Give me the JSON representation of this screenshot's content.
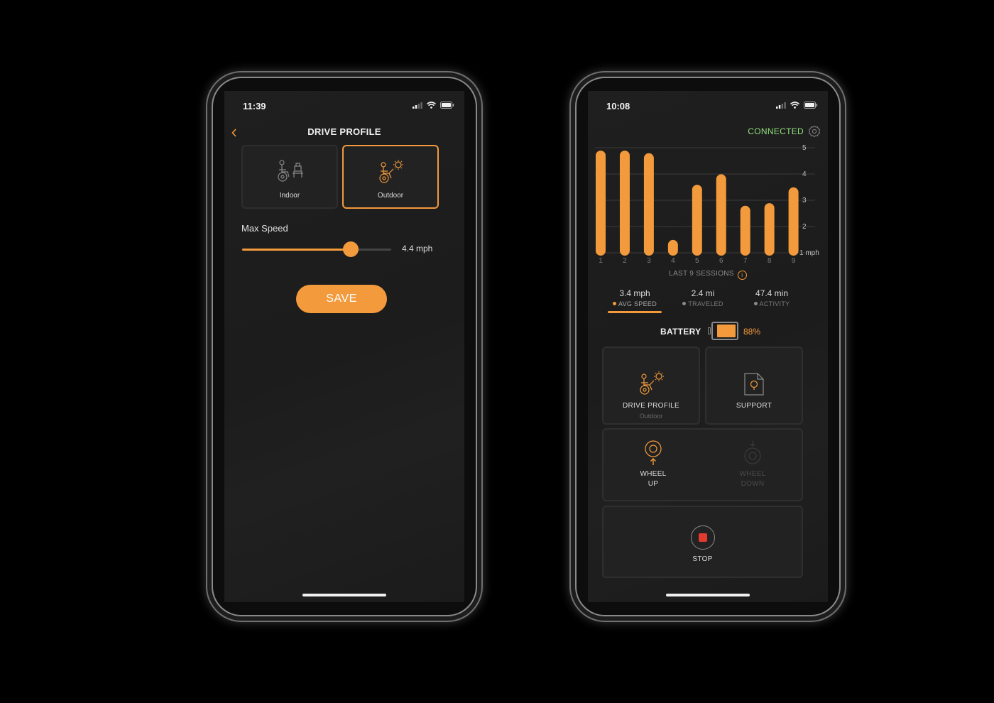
{
  "colors": {
    "accent": "#f39a3c",
    "connected": "#8fe07a",
    "stop": "#e23b2e",
    "bg": "#1e1e1e"
  },
  "left": {
    "status_time": "11:39",
    "title": "DRIVE PROFILE",
    "back_icon": "chevron-left-icon",
    "profiles": [
      {
        "label": "Indoor",
        "icon": "wheelchair-indoor-icon",
        "selected": false
      },
      {
        "label": "Outdoor",
        "icon": "wheelchair-outdoor-icon",
        "selected": true
      }
    ],
    "max_speed_label": "Max Speed",
    "max_speed_value": "4.4 mph",
    "slider_fraction": 0.73,
    "save_label": "SAVE"
  },
  "right": {
    "status_time": "10:08",
    "connection_status": "CONNECTED",
    "settings_icon": "gear-icon",
    "sessions_label": "LAST 9 SESSIONS",
    "stats": [
      {
        "value": "3.4 mph",
        "label": "AVG SPEED",
        "active": true
      },
      {
        "value": "2.4 mi",
        "label": "TRAVELED",
        "active": false
      },
      {
        "value": "47.4 min",
        "label": "ACTIVITY",
        "active": false
      }
    ],
    "battery_label": "BATTERY",
    "battery_percent": "88%",
    "battery_fraction": 0.88,
    "tiles": {
      "drive_profile": {
        "label": "DRIVE PROFILE",
        "sub": "Outdoor"
      },
      "support": {
        "label": "SUPPORT"
      },
      "wheel_up": {
        "line1": "WHEEL",
        "line2": "UP"
      },
      "wheel_down": {
        "line1": "WHEEL",
        "line2": "DOWN"
      },
      "stop": {
        "label": "STOP"
      }
    }
  },
  "chart_data": {
    "type": "bar",
    "categories": [
      "1",
      "2",
      "3",
      "4",
      "5",
      "6",
      "7",
      "8",
      "9"
    ],
    "values": [
      4.7,
      4.7,
      4.6,
      1.3,
      3.4,
      3.8,
      2.6,
      2.7,
      3.3
    ],
    "ylim": [
      1,
      5
    ],
    "yticks": [
      "1 mph",
      "2",
      "3",
      "4",
      "5"
    ],
    "grid": true
  }
}
